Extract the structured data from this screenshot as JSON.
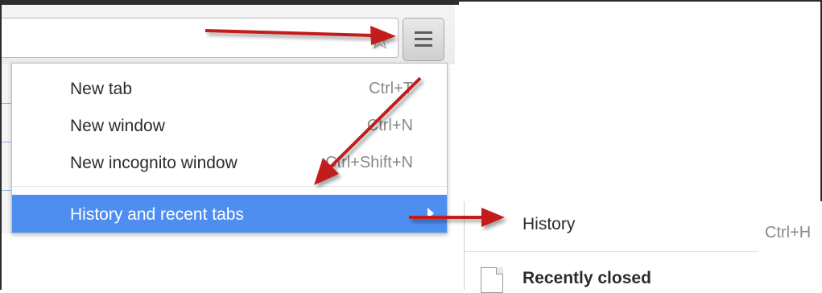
{
  "menu": {
    "items": [
      {
        "label": "New tab",
        "shortcut": "Ctrl+T"
      },
      {
        "label": "New window",
        "shortcut": "Ctrl+N"
      },
      {
        "label": "New incognito window",
        "shortcut": "Ctrl+Shift+N"
      }
    ],
    "highlighted_item": {
      "label": "History and recent tabs"
    }
  },
  "submenu": {
    "history_label": "History",
    "history_shortcut": "Ctrl+H",
    "recently_closed_label": "Recently closed"
  },
  "icons": {
    "bookmark": "star-icon",
    "menu": "hamburger-icon",
    "recent": "page-icon"
  },
  "colors": {
    "highlight": "#4d8ef0",
    "annotation_arrow": "#c21c1c"
  }
}
